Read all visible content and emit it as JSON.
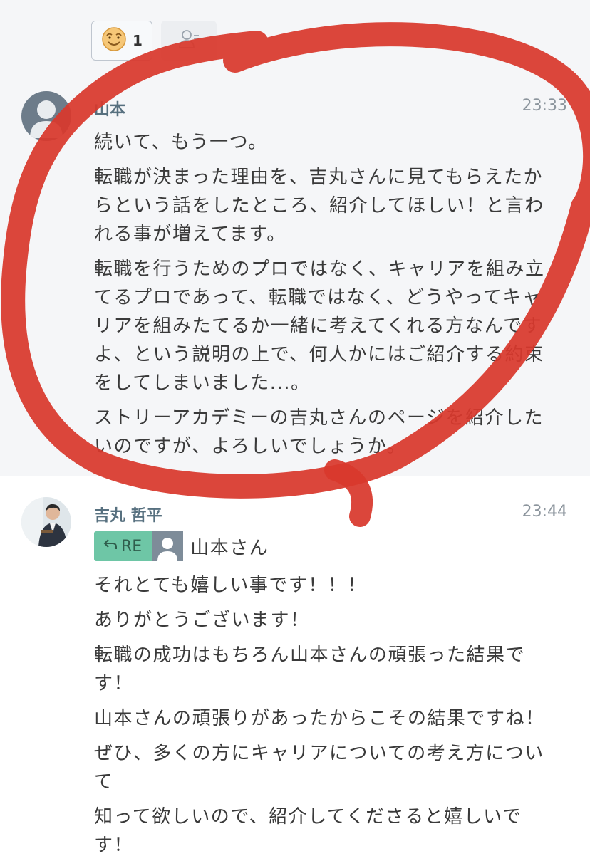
{
  "reactions": {
    "count": "1"
  },
  "messages": [
    {
      "sender": "山本",
      "time": "23:33",
      "paragraphs": [
        "続いて、もう一つ。",
        "転職が決まった理由を、吉丸さんに見てもらえたか\nらという話をしたところ、紹介してほしい！と言わ\nれる事が増えてます。",
        "転職を行うためのプロではなく、キャリアを組み立\nてるプロであって、転職ではなく、どうやってキャ\nリアを組みたてるか一緒に考えてくれる方なんです\nよ、という説明の上で、何人かにはご紹介する約束\nをしてしまいました...。",
        "ストリーアカデミーの吉丸さんのページを紹介した\nいのですが、よろしいでしょうか。"
      ]
    },
    {
      "sender": "吉丸 哲平",
      "time": "23:44",
      "reply": {
        "badge": "RE",
        "to": "山本さん"
      },
      "paragraphs": [
        "それとても嬉しい事です！！！",
        "ありがとうございます！",
        "転職の成功はもちろん山本さんの頑張った結果で\nす！",
        "山本さんの頑張りがあったからこその結果ですね！",
        "ぜひ、多くの方にキャリアについての考え方につい\nて",
        "知って欲しいので、紹介してくださると嬉しいで\nす！"
      ]
    }
  ]
}
